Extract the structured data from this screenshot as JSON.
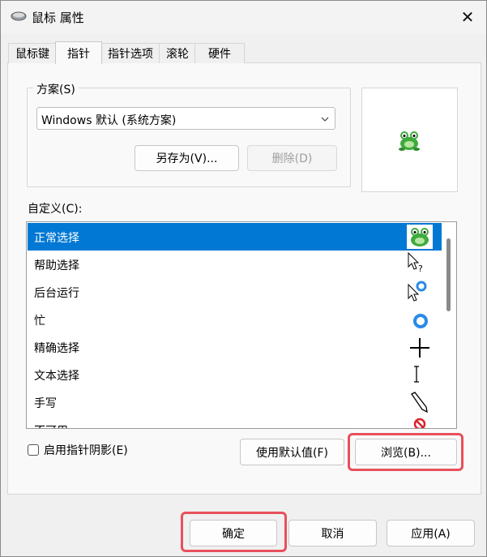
{
  "window": {
    "title": "鼠标 属性",
    "close_glyph": "✕"
  },
  "tabs": [
    {
      "label": "鼠标键"
    },
    {
      "label": "指针",
      "active": true
    },
    {
      "label": "指针选项"
    },
    {
      "label": "滚轮"
    },
    {
      "label": "硬件"
    }
  ],
  "scheme": {
    "group_label": "方案(S)",
    "selected": "Windows 默认 (系统方案)",
    "save_as_label": "另存为(V)...",
    "delete_label": "删除(D)"
  },
  "preview": {
    "icon": "frog-icon"
  },
  "customize": {
    "label": "自定义(C):",
    "items": [
      {
        "label": "正常选择",
        "icon": "frog-icon",
        "selected": true
      },
      {
        "label": "帮助选择",
        "icon": "help-select-cursor-icon"
      },
      {
        "label": "后台运行",
        "icon": "working-in-background-cursor-icon"
      },
      {
        "label": "忙",
        "icon": "busy-cursor-icon"
      },
      {
        "label": "精确选择",
        "icon": "crosshair-cursor-icon"
      },
      {
        "label": "文本选择",
        "icon": "text-beam-cursor-icon"
      },
      {
        "label": "手写",
        "icon": "pen-cursor-icon"
      },
      {
        "label": "不可用",
        "icon": "unavailable-cursor-icon"
      }
    ]
  },
  "shadow_checkbox": {
    "label": "启用指针阴影(E)",
    "checked": false
  },
  "use_default_label": "使用默认值(F)",
  "browse_label": "浏览(B)...",
  "footer": {
    "ok_label": "确定",
    "cancel_label": "取消",
    "apply_label": "应用(A)"
  },
  "colors": {
    "selection": "#0078d4",
    "highlight": "#e8505b"
  }
}
